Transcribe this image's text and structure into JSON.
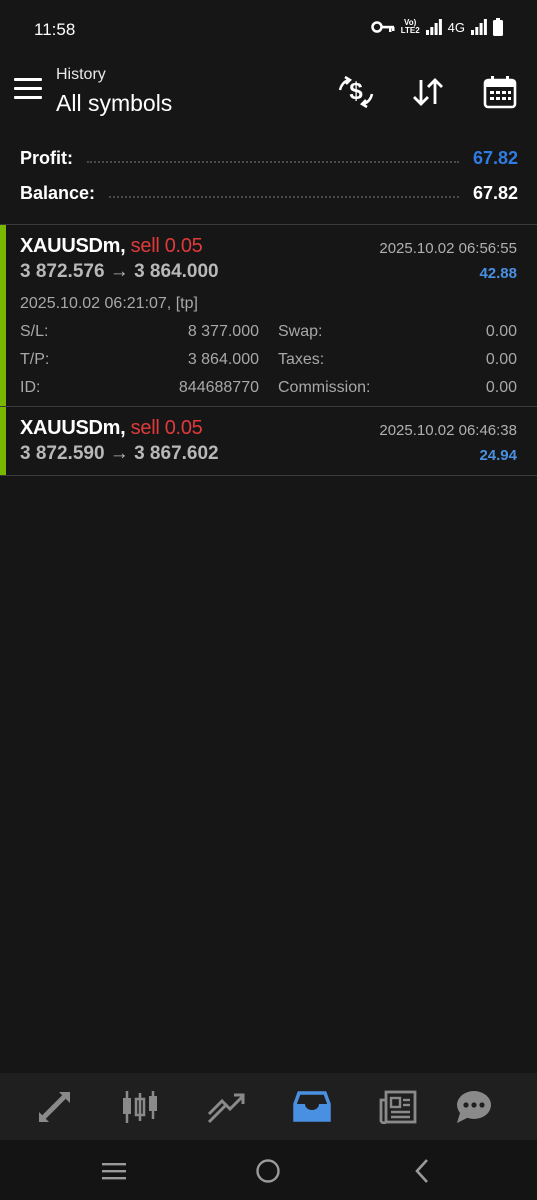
{
  "status_bar": {
    "time": "11:58",
    "lte_top": "Vo)",
    "lte_bottom": "LTE2",
    "network": "4G"
  },
  "header": {
    "subtitle": "History",
    "title": "All symbols",
    "icons": [
      "menu-icon",
      "dollar-exchange-icon",
      "sort-icon",
      "calendar-icon"
    ]
  },
  "summary": {
    "profit_label": "Profit:",
    "profit_value": "67.82",
    "balance_label": "Balance:",
    "balance_value": "67.82"
  },
  "colors": {
    "accent_blue": "#4a90e2",
    "profit_blue": "#2f7de1",
    "sell_red": "#e03a3a",
    "deal_bar_green": "#7ab800",
    "background": "#161616"
  },
  "deals": [
    {
      "symbol": "XAUUSDm,",
      "type": "sell 0.05",
      "close_time": "2025.10.02 06:56:55",
      "prices": "3 872.576 → 3 864.000",
      "profit": "42.88",
      "open_info": "2025.10.02 06:21:07, [tp]",
      "sl_label": "S/L:",
      "sl_value": "8 377.000",
      "tp_label": "T/P:",
      "tp_value": "3 864.000",
      "id_label": "ID:",
      "id_value": "844688770",
      "swap_label": "Swap:",
      "swap_value": "0.00",
      "taxes_label": "Taxes:",
      "taxes_value": "0.00",
      "commission_label": "Commission:",
      "commission_value": "0.00"
    },
    {
      "symbol": "XAUUSDm,",
      "type": "sell 0.05",
      "close_time": "2025.10.02 06:46:38",
      "prices": "3 872.590 → 3 867.602",
      "profit": "24.94"
    }
  ],
  "bottom_nav": {
    "items": [
      "quotes-icon",
      "chart-icon",
      "trade-icon",
      "history-icon",
      "news-icon",
      "messages-icon"
    ],
    "active": "history-icon"
  },
  "system_nav": {
    "items": [
      "recents-icon",
      "home-icon",
      "back-icon"
    ]
  }
}
